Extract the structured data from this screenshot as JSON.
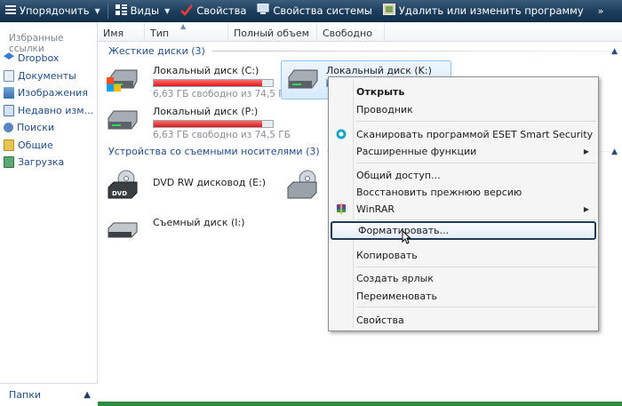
{
  "toolbar": {
    "organize": "Упорядочить",
    "views": "Виды",
    "properties": "Свойства",
    "system_properties": "Свойства системы",
    "uninstall": "Удалить или изменить программу",
    "more": "»"
  },
  "nav": {
    "title": "Избранные ссылки",
    "items": [
      "Dropbox",
      "Документы",
      "Изображения",
      "Недавно изм...",
      "Поиски",
      "Общие",
      "Загрузка"
    ],
    "footer": "Папки"
  },
  "columns": [
    "Имя",
    "Тип",
    "Полный объем",
    "Свободно"
  ],
  "groups": {
    "hard_disks": "Жесткие диски (3)",
    "removable": "Устройства со съемными носителями (3)"
  },
  "drives": [
    {
      "name": "Локальный диск (C:)",
      "free": "6,63 ГБ свободно из 74,5 ГБ",
      "used_fraction": 0.91
    },
    {
      "name": "Локальный диск (K:)",
      "free": "",
      "used_fraction": 0.9
    },
    {
      "name": "Локальный диск (P:)",
      "free": "6,63 ГБ свободно из 74,5 ГБ",
      "used_fraction": 0.91
    }
  ],
  "removable_drives": [
    {
      "name": "DVD RW дисковод (E:)",
      "badge": "DVD"
    },
    {
      "name": "Съемный диск (I:)"
    }
  ],
  "context_menu": {
    "open": "Открыть",
    "explorer": "Проводник",
    "scan": "Сканировать программой ESET Smart Security",
    "advanced": "Расширенные функции",
    "sharing": "Общий доступ...",
    "restore": "Восстановить прежнюю версию",
    "winrar": "WinRAR",
    "format": "Форматировать...",
    "copy": "Копировать",
    "shortcut": "Создать ярлык",
    "rename": "Переименовать",
    "props": "Свойства"
  },
  "colors": {
    "bar_red": "#d91a1a",
    "bar_blue": "#1b72c8",
    "status_green": "#2f8a3e"
  }
}
